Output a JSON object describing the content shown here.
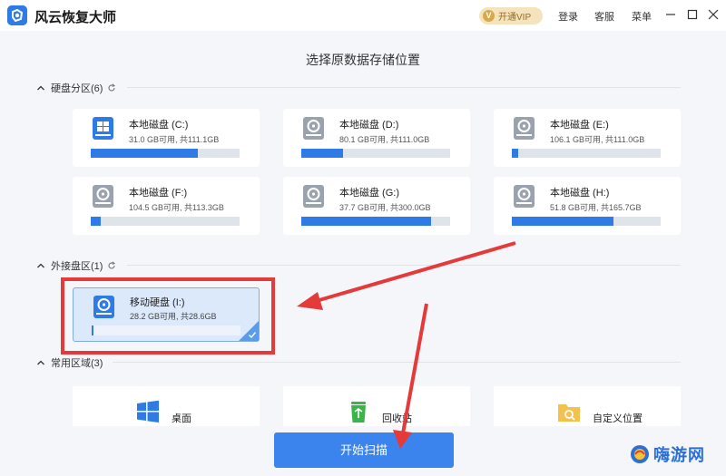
{
  "app": {
    "title": "风云恢复大师"
  },
  "topbar": {
    "vip_label": "开通VIP",
    "vip_icon": "V",
    "login": "登录",
    "service": "客服",
    "menu": "菜单"
  },
  "main": {
    "title": "选择原数据存储位置"
  },
  "sections": {
    "partitions": {
      "label": "硬盘分区(6)"
    },
    "external": {
      "label": "外接盘区(1)"
    },
    "common": {
      "label": "常用区域(3)"
    }
  },
  "partitions": [
    {
      "name": "本地磁盘 (C:)",
      "capacity": "31.0 GB可用, 共111.1GB",
      "used_fraction": 0.72,
      "system": true
    },
    {
      "name": "本地磁盘 (D:)",
      "capacity": "80.1 GB可用, 共111.0GB",
      "used_fraction": 0.28
    },
    {
      "name": "本地磁盘 (E:)",
      "capacity": "106.1 GB可用, 共111.0GB",
      "used_fraction": 0.04
    },
    {
      "name": "本地磁盘 (F:)",
      "capacity": "104.5 GB可用, 共113.3GB",
      "used_fraction": 0.07
    },
    {
      "name": "本地磁盘 (G:)",
      "capacity": "37.7 GB可用, 共300.0GB",
      "used_fraction": 0.87
    },
    {
      "name": "本地磁盘 (H:)",
      "capacity": "51.8 GB可用, 共165.7GB",
      "used_fraction": 0.68
    }
  ],
  "external": [
    {
      "name": "移动硬盘 (I:)",
      "capacity": "28.2 GB可用, 共28.6GB",
      "used_fraction": 0.01,
      "selected": true
    }
  ],
  "common": [
    {
      "label": "桌面",
      "icon": "windows-icon"
    },
    {
      "label": "回收站",
      "icon": "recycle-bin-icon"
    },
    {
      "label": "自定义位置",
      "icon": "folder-search-icon"
    }
  ],
  "scan_button": {
    "label": "开始扫描"
  },
  "watermark": {
    "text": "嗨游网"
  },
  "colors": {
    "accent": "#2f7be6",
    "annotation_red": "#e53a3a",
    "background": "#f4f6fa"
  }
}
